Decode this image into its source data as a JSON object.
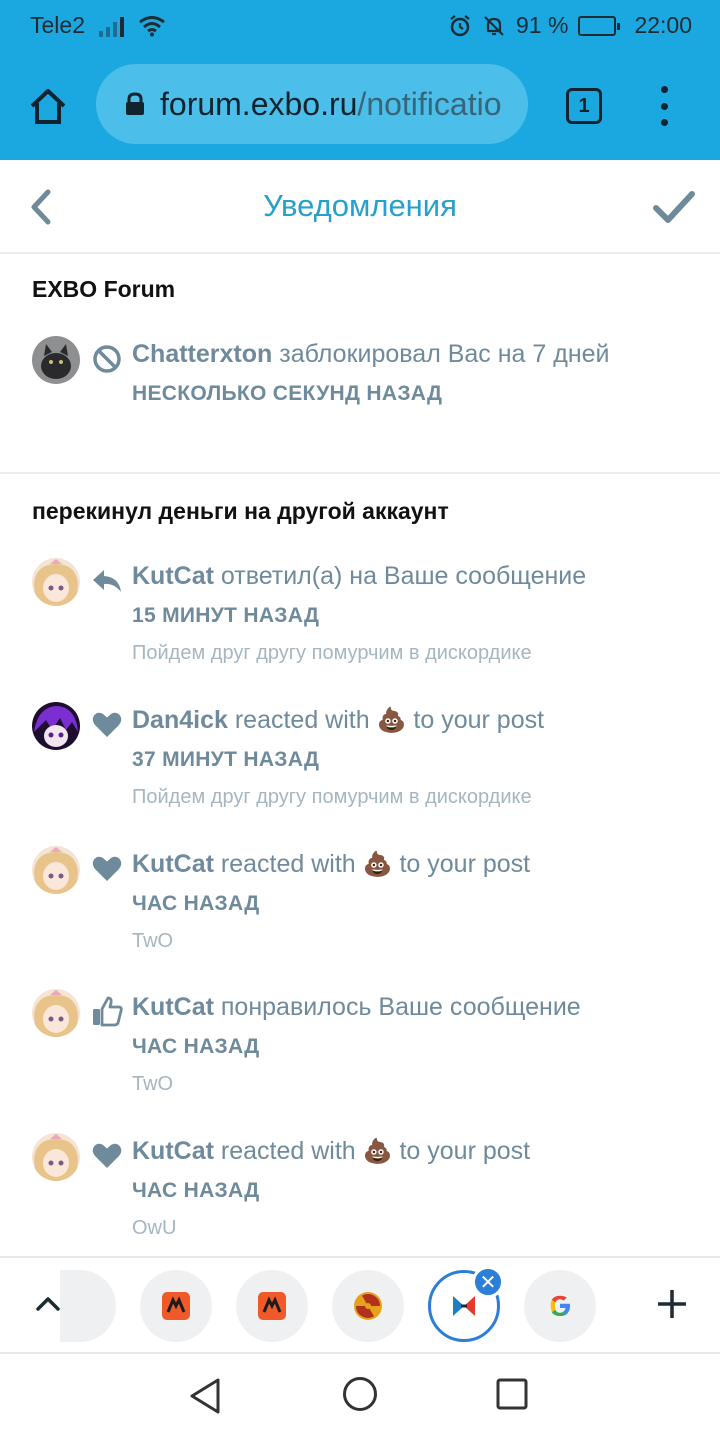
{
  "status_bar": {
    "carrier": "Tele2",
    "battery_text": "91 %",
    "battery_level": 0.91,
    "time": "22:00"
  },
  "browser": {
    "url_host": "forum.exbo.ru",
    "url_path": "/notificatio",
    "tab_count": "1"
  },
  "header": {
    "title": "Уведомления"
  },
  "groups": [
    {
      "title": "EXBO Forum",
      "items": [
        {
          "user": "Chatterxton",
          "action": " заблокировал Вас на 7 дней",
          "time": "НЕСКОЛЬКО СЕКУНД НАЗАД",
          "excerpt": "",
          "icon": "ban-icon",
          "avatar": "avatar-cat"
        }
      ]
    },
    {
      "title": "перекинул деньги на другой аккаунт",
      "items": [
        {
          "user": "KutCat",
          "action": " ответил(а) на Ваше сообщение",
          "time": "15 МИНУТ НАЗАД",
          "excerpt": "Пойдем друг другу помурчим в дискордике",
          "icon": "reply-icon",
          "avatar": "avatar-anime-blonde"
        },
        {
          "user": "Dan4ick",
          "action_pre": " reacted with ",
          "emoji": "💩",
          "action_post": " to your post",
          "time": "37 МИНУТ НАЗАД",
          "excerpt": "Пойдем друг другу помурчим в дискордике",
          "icon": "heart-icon",
          "avatar": "avatar-anime-purple"
        },
        {
          "user": "KutCat",
          "action_pre": " reacted with ",
          "emoji": "💩",
          "action_post": " to your post",
          "time": "ЧАС НАЗАД",
          "excerpt": "TwO",
          "icon": "heart-icon",
          "avatar": "avatar-anime-blonde"
        },
        {
          "user": "KutCat",
          "action": " понравилось Ваше сообщение",
          "time": "ЧАС НАЗАД",
          "excerpt": "TwO",
          "icon": "thumbs-up-icon",
          "avatar": "avatar-anime-blonde"
        },
        {
          "user": "KutCat",
          "action_pre": " reacted with ",
          "emoji": "💩",
          "action_post": " to your post",
          "time": "ЧАС НАЗАД",
          "excerpt": "OwU",
          "icon": "heart-icon",
          "avatar": "avatar-anime-blonde"
        }
      ]
    }
  ],
  "colors": {
    "browser_blue": "#1ba7e0",
    "title_blue": "#26a0cc",
    "text_gray": "#6f8a9a",
    "excerpt_gray": "#a6b6c0",
    "active_tab_blue": "#2b7fd6"
  }
}
